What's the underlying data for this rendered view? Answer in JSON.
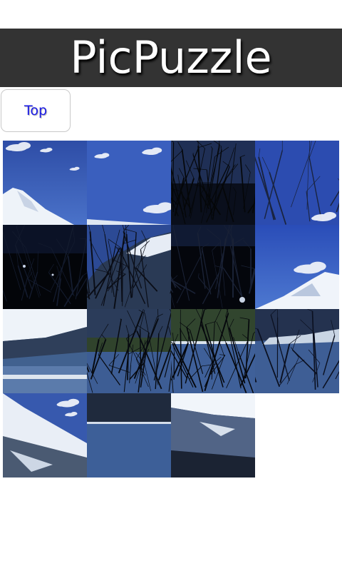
{
  "app": {
    "title": "PicPuzzle"
  },
  "toolbar": {
    "top_label": "Top"
  },
  "puzzle": {
    "rows": 4,
    "cols": 4,
    "tiles": [
      {
        "kind": "sky-fuji-left",
        "state": "filled"
      },
      {
        "kind": "sky-fuji-right",
        "state": "filled"
      },
      {
        "kind": "dark-branches-sky",
        "state": "filled"
      },
      {
        "kind": "sky-branches-edge",
        "state": "filled"
      },
      {
        "kind": "dark-forest",
        "state": "filled"
      },
      {
        "kind": "branches-snow-slope",
        "state": "filled"
      },
      {
        "kind": "dark-forest-branches",
        "state": "filled"
      },
      {
        "kind": "fuji-peak-right",
        "state": "filled"
      },
      {
        "kind": "snowy-slope-lake",
        "state": "filled"
      },
      {
        "kind": "branches-lake",
        "state": "filled"
      },
      {
        "kind": "branches-lake-shore",
        "state": "filled"
      },
      {
        "kind": "lake-shore-right",
        "state": "filled"
      },
      {
        "kind": "snowy-mountain-side",
        "state": "filled"
      },
      {
        "kind": "lake-water",
        "state": "filled"
      },
      {
        "kind": "snowy-slope-dark",
        "state": "filled"
      },
      {
        "kind": "empty",
        "state": "empty"
      }
    ]
  },
  "colors": {
    "title_bar_bg": "#333333",
    "title_text": "#ffffff",
    "button_text": "#1a1ae6",
    "sky": "#2f4fa8",
    "deep_sky": "#1e3a95",
    "snow": "#e8eef7",
    "dark": "#05070f",
    "lake": "#3b5a8f"
  }
}
